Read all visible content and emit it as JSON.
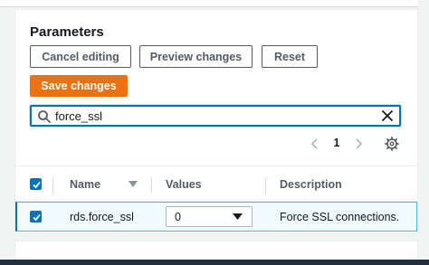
{
  "panel": {
    "title": "Parameters"
  },
  "actions": {
    "cancel_label": "Cancel editing",
    "preview_label": "Preview changes",
    "reset_label": "Reset",
    "save_label": "Save changes"
  },
  "search": {
    "value": "force_ssl",
    "icon": "search-icon",
    "clear_icon": "close-icon"
  },
  "pagination": {
    "current_page": "1",
    "prev_icon": "chevron-left-icon",
    "next_icon": "chevron-right-icon",
    "settings_icon": "gear-icon"
  },
  "table": {
    "columns": {
      "name": "Name",
      "values": "Values",
      "description": "Description"
    },
    "header_checkbox_checked": true,
    "rows": [
      {
        "selected": true,
        "name": "rds.force_ssl",
        "value": "0",
        "description": "Force SSL connections."
      }
    ]
  },
  "colors": {
    "primary": "#ec7211",
    "accent": "#0073bb",
    "selected_row_bg": "#f1faff"
  }
}
